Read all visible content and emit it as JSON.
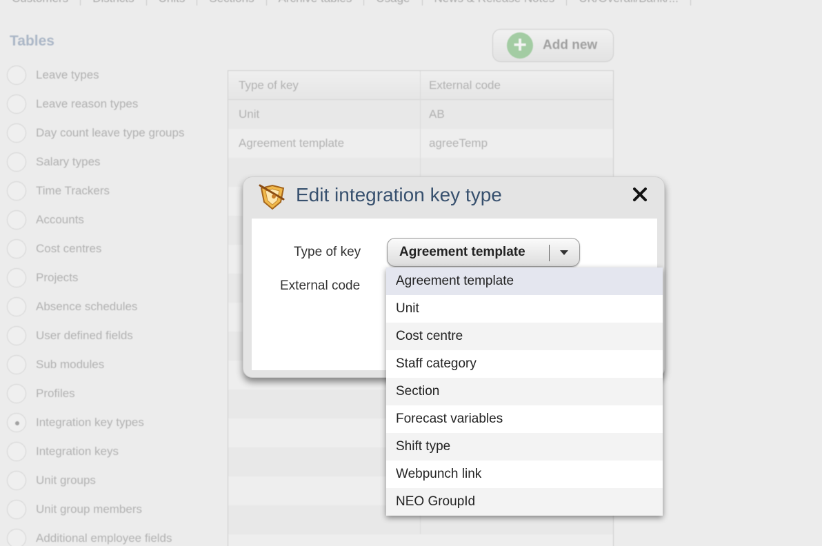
{
  "top_nav": [
    "Customers",
    "Districts",
    "Units",
    "Sections",
    "Archive tables",
    "Usage",
    "News & Release Notes",
    "UK/Overall/Bank/..."
  ],
  "sidebar": {
    "title": "Tables",
    "items": [
      {
        "label": "Leave types",
        "checked": false
      },
      {
        "label": "Leave reason types",
        "checked": false
      },
      {
        "label": "Day count leave type groups",
        "checked": false
      },
      {
        "label": "Salary types",
        "checked": false
      },
      {
        "label": "Time Trackers",
        "checked": false
      },
      {
        "label": "Accounts",
        "checked": false
      },
      {
        "label": "Cost centres",
        "checked": false
      },
      {
        "label": "Projects",
        "checked": false
      },
      {
        "label": "Absence schedules",
        "checked": false
      },
      {
        "label": "User defined fields",
        "checked": false
      },
      {
        "label": "Sub modules",
        "checked": false
      },
      {
        "label": "Profiles",
        "checked": false
      },
      {
        "label": "Integration key types",
        "checked": true
      },
      {
        "label": "Integration keys",
        "checked": false
      },
      {
        "label": "Unit groups",
        "checked": false
      },
      {
        "label": "Unit group members",
        "checked": false
      },
      {
        "label": "Additional employee fields",
        "checked": false
      }
    ]
  },
  "toolbar": {
    "add_new_label": "Add new"
  },
  "table": {
    "columns": [
      "Type of key",
      "External code"
    ],
    "rows": [
      [
        "Unit",
        "AB"
      ],
      [
        "Agreement template",
        "agreeTemp"
      ]
    ]
  },
  "dialog": {
    "title": "Edit integration key type",
    "type_of_key_label": "Type of key",
    "external_code_label": "External code",
    "selected_value": "Agreement template",
    "icon": "badge-edit-icon",
    "close_icon": "close-icon"
  },
  "dropdown": {
    "options": [
      "Agreement template",
      "Unit",
      "Cost centre",
      "Staff category",
      "Section",
      "Forecast variables",
      "Shift type",
      "Webpunch link",
      "NEO GroupId"
    ],
    "highlighted_index": 0
  },
  "colors": {
    "title_blue": "#37506e",
    "sidebar_heading": "#5a7599",
    "add_green": "#4aa64a"
  }
}
